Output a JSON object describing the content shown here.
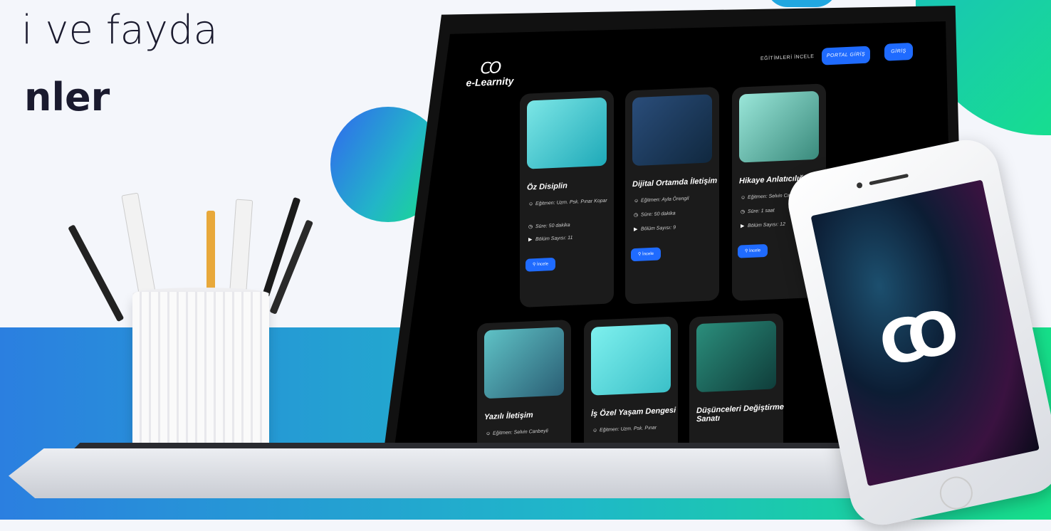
{
  "headline": {
    "line1": "i ve fayda",
    "line2": "nler"
  },
  "site": {
    "logo_mark": "CO",
    "logo_text": "e-Learnity",
    "nav": {
      "courses": "EĞİTİMLERİ İNCELE",
      "portal": "PORTAL GİRİŞ",
      "login": "GİRİŞ"
    }
  },
  "courses": [
    {
      "title": "Öz Disiplin",
      "instructor": "Eğitmen: Uzm. Psk. Pınar Kopar",
      "duration": "Süre: 50 dakika",
      "sections": "Bölüm Sayısı: 11",
      "button": "İncele"
    },
    {
      "title": "Dijital Ortamda İletişim",
      "instructor": "Eğitmen: Ayla Örengil",
      "duration": "Süre: 50 dakika",
      "sections": "Bölüm Sayısı: 9",
      "button": "İncele"
    },
    {
      "title": "Hikaye Anlatıcılığı",
      "instructor": "Eğitmen: Selvin Canbeyli",
      "duration": "Süre: 1 saat",
      "sections": "Bölüm Sayısı: 12",
      "button": "İncele"
    },
    {
      "title": "Yazılı İletişim",
      "instructor": "Eğitmen: Selvin Canbeyli"
    },
    {
      "title": "İş Özel Yaşam Dengesi",
      "instructor": "Eğitmen: Uzm. Psk. Pınar"
    },
    {
      "title": "Düşünceleri Değiştirme Sanatı"
    }
  ],
  "colors": {
    "accent": "#1f6bff",
    "gradient_start": "#2b7fe0",
    "gradient_end": "#16e08a"
  }
}
